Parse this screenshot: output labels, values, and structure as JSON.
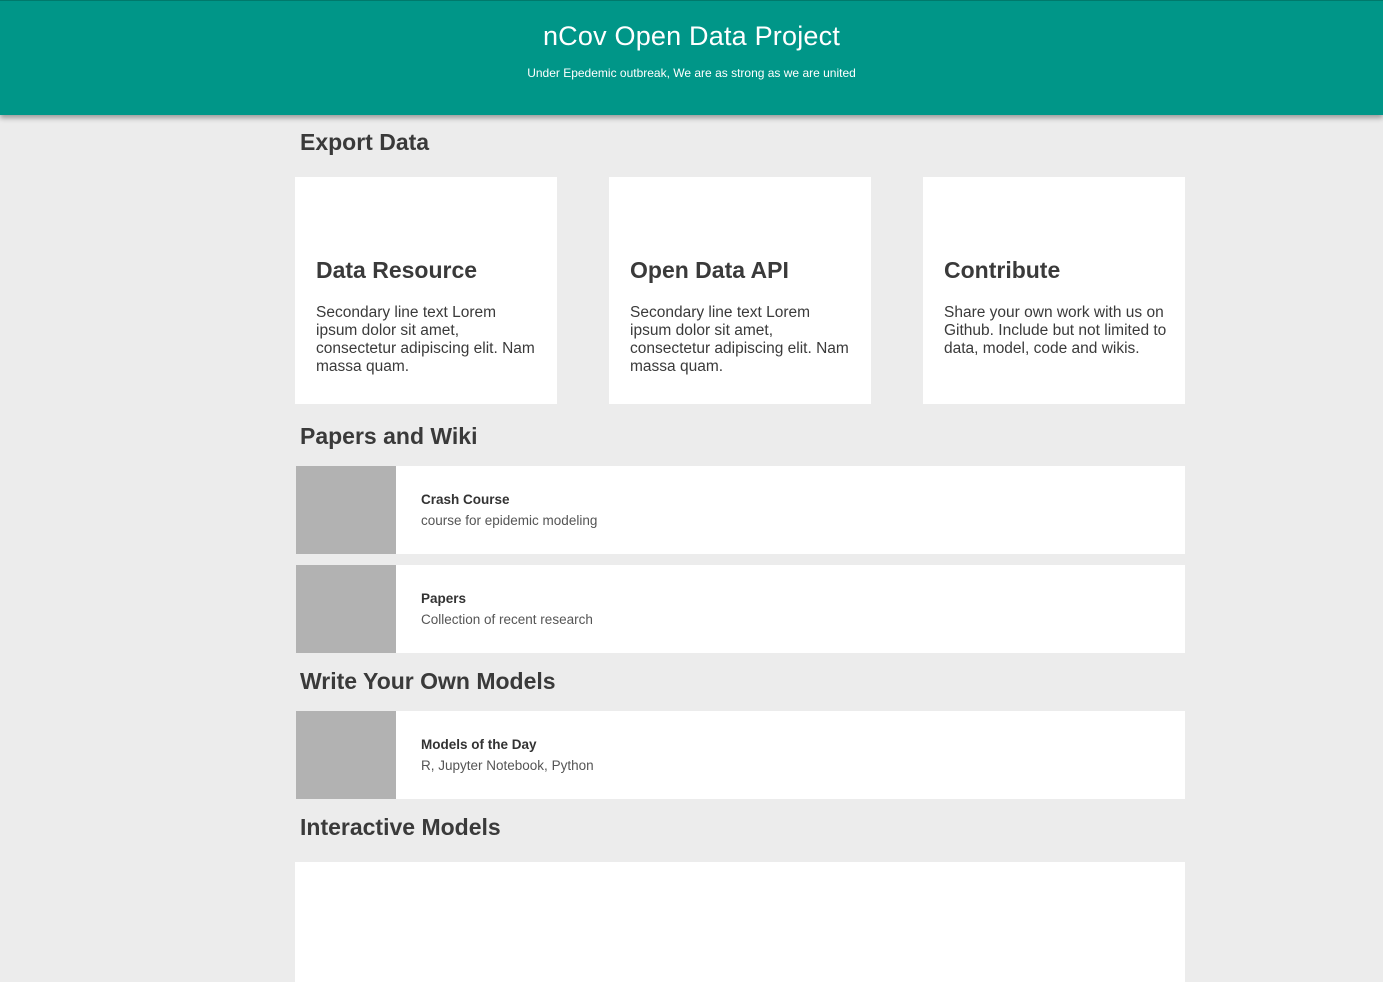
{
  "header": {
    "title": "nCov Open Data Project",
    "subtitle": "Under Epedemic outbreak, We are as strong as we are united",
    "background_color": "#009688"
  },
  "sections": {
    "export_data": {
      "title": "Export Data",
      "cards": [
        {
          "title": "Data Resource",
          "text": "Secondary line text Lorem ipsum dolor sit amet, consectetur adipiscing elit. Nam massa quam."
        },
        {
          "title": "Open Data API",
          "text": "Secondary line text Lorem ipsum dolor sit amet, consectetur adipiscing elit. Nam massa quam."
        },
        {
          "title": "Contribute",
          "text": "Share your own work with us on Github. Include but not limited to data, model, code and wikis."
        }
      ]
    },
    "papers_and_wiki": {
      "title": "Papers and Wiki",
      "items": [
        {
          "title": "Crash Course",
          "description": "course for epidemic modeling"
        },
        {
          "title": "Papers",
          "description": "Collection of recent research"
        }
      ]
    },
    "write_models": {
      "title": "Write Your Own Models",
      "items": [
        {
          "title": "Models of the Day",
          "description": "R, Jupyter Notebook, Python"
        }
      ]
    },
    "interactive_models": {
      "title": "Interactive Models"
    }
  },
  "colors": {
    "page_background": "#ececec",
    "card_background": "#ffffff",
    "thumbnail_placeholder": "#b2b2b2"
  }
}
